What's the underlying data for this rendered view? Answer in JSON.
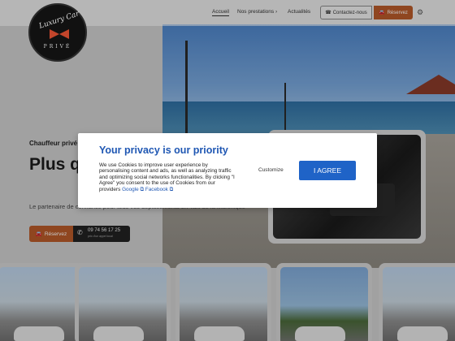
{
  "header": {
    "logo_script": "Luxury Car",
    "logo_word": "PRIVÉ",
    "nav": [
      {
        "label": "Accueil"
      },
      {
        "label": "Nos prestations"
      },
      {
        "label": "Actualités"
      }
    ],
    "nav_chevron": "›",
    "contact_label": "Contactez-nous",
    "reserve_label": "Réservez",
    "settings_icon": "gear-icon",
    "accent": "#b85a2a"
  },
  "hero": {
    "subtitle": "Chauffeur privé",
    "title": "Plus q service",
    "description": "Le partenaire de confiance pour tous vos déplacements en Taxi de la Martinique",
    "reserve_label": "Réservez",
    "phone_number": "09 74 56 17 25",
    "phone_note": "prix d'un appel local"
  },
  "cookie": {
    "title": "Your privacy is our priority",
    "text": "We use Cookies to improve user experience by personalising content and ads, as well as analyzing traffic and optimizing social networks functionalities. By clicking \"I Agree\" you consent to the use of Cookies from our providers",
    "link_google": "Google",
    "link_facebook": "Facebook",
    "customize_label": "Customize",
    "agree_label": "I AGREE",
    "accent": "#1f63c7"
  }
}
